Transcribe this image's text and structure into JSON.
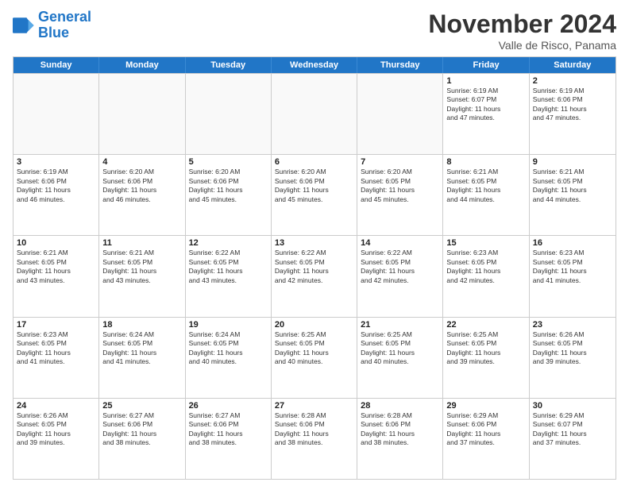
{
  "header": {
    "logo_line1": "General",
    "logo_line2": "Blue",
    "month_title": "November 2024",
    "location": "Valle de Risco, Panama"
  },
  "day_headers": [
    "Sunday",
    "Monday",
    "Tuesday",
    "Wednesday",
    "Thursday",
    "Friday",
    "Saturday"
  ],
  "weeks": [
    [
      {
        "day": "",
        "info": "",
        "empty": true
      },
      {
        "day": "",
        "info": "",
        "empty": true
      },
      {
        "day": "",
        "info": "",
        "empty": true
      },
      {
        "day": "",
        "info": "",
        "empty": true
      },
      {
        "day": "",
        "info": "",
        "empty": true
      },
      {
        "day": "1",
        "info": "Sunrise: 6:19 AM\nSunset: 6:07 PM\nDaylight: 11 hours\nand 47 minutes."
      },
      {
        "day": "2",
        "info": "Sunrise: 6:19 AM\nSunset: 6:06 PM\nDaylight: 11 hours\nand 47 minutes."
      }
    ],
    [
      {
        "day": "3",
        "info": "Sunrise: 6:19 AM\nSunset: 6:06 PM\nDaylight: 11 hours\nand 46 minutes."
      },
      {
        "day": "4",
        "info": "Sunrise: 6:20 AM\nSunset: 6:06 PM\nDaylight: 11 hours\nand 46 minutes."
      },
      {
        "day": "5",
        "info": "Sunrise: 6:20 AM\nSunset: 6:06 PM\nDaylight: 11 hours\nand 45 minutes."
      },
      {
        "day": "6",
        "info": "Sunrise: 6:20 AM\nSunset: 6:06 PM\nDaylight: 11 hours\nand 45 minutes."
      },
      {
        "day": "7",
        "info": "Sunrise: 6:20 AM\nSunset: 6:05 PM\nDaylight: 11 hours\nand 45 minutes."
      },
      {
        "day": "8",
        "info": "Sunrise: 6:21 AM\nSunset: 6:05 PM\nDaylight: 11 hours\nand 44 minutes."
      },
      {
        "day": "9",
        "info": "Sunrise: 6:21 AM\nSunset: 6:05 PM\nDaylight: 11 hours\nand 44 minutes."
      }
    ],
    [
      {
        "day": "10",
        "info": "Sunrise: 6:21 AM\nSunset: 6:05 PM\nDaylight: 11 hours\nand 43 minutes."
      },
      {
        "day": "11",
        "info": "Sunrise: 6:21 AM\nSunset: 6:05 PM\nDaylight: 11 hours\nand 43 minutes."
      },
      {
        "day": "12",
        "info": "Sunrise: 6:22 AM\nSunset: 6:05 PM\nDaylight: 11 hours\nand 43 minutes."
      },
      {
        "day": "13",
        "info": "Sunrise: 6:22 AM\nSunset: 6:05 PM\nDaylight: 11 hours\nand 42 minutes."
      },
      {
        "day": "14",
        "info": "Sunrise: 6:22 AM\nSunset: 6:05 PM\nDaylight: 11 hours\nand 42 minutes."
      },
      {
        "day": "15",
        "info": "Sunrise: 6:23 AM\nSunset: 6:05 PM\nDaylight: 11 hours\nand 42 minutes."
      },
      {
        "day": "16",
        "info": "Sunrise: 6:23 AM\nSunset: 6:05 PM\nDaylight: 11 hours\nand 41 minutes."
      }
    ],
    [
      {
        "day": "17",
        "info": "Sunrise: 6:23 AM\nSunset: 6:05 PM\nDaylight: 11 hours\nand 41 minutes."
      },
      {
        "day": "18",
        "info": "Sunrise: 6:24 AM\nSunset: 6:05 PM\nDaylight: 11 hours\nand 41 minutes."
      },
      {
        "day": "19",
        "info": "Sunrise: 6:24 AM\nSunset: 6:05 PM\nDaylight: 11 hours\nand 40 minutes."
      },
      {
        "day": "20",
        "info": "Sunrise: 6:25 AM\nSunset: 6:05 PM\nDaylight: 11 hours\nand 40 minutes."
      },
      {
        "day": "21",
        "info": "Sunrise: 6:25 AM\nSunset: 6:05 PM\nDaylight: 11 hours\nand 40 minutes."
      },
      {
        "day": "22",
        "info": "Sunrise: 6:25 AM\nSunset: 6:05 PM\nDaylight: 11 hours\nand 39 minutes."
      },
      {
        "day": "23",
        "info": "Sunrise: 6:26 AM\nSunset: 6:05 PM\nDaylight: 11 hours\nand 39 minutes."
      }
    ],
    [
      {
        "day": "24",
        "info": "Sunrise: 6:26 AM\nSunset: 6:05 PM\nDaylight: 11 hours\nand 39 minutes."
      },
      {
        "day": "25",
        "info": "Sunrise: 6:27 AM\nSunset: 6:06 PM\nDaylight: 11 hours\nand 38 minutes."
      },
      {
        "day": "26",
        "info": "Sunrise: 6:27 AM\nSunset: 6:06 PM\nDaylight: 11 hours\nand 38 minutes."
      },
      {
        "day": "27",
        "info": "Sunrise: 6:28 AM\nSunset: 6:06 PM\nDaylight: 11 hours\nand 38 minutes."
      },
      {
        "day": "28",
        "info": "Sunrise: 6:28 AM\nSunset: 6:06 PM\nDaylight: 11 hours\nand 38 minutes."
      },
      {
        "day": "29",
        "info": "Sunrise: 6:29 AM\nSunset: 6:06 PM\nDaylight: 11 hours\nand 37 minutes."
      },
      {
        "day": "30",
        "info": "Sunrise: 6:29 AM\nSunset: 6:07 PM\nDaylight: 11 hours\nand 37 minutes."
      }
    ]
  ]
}
